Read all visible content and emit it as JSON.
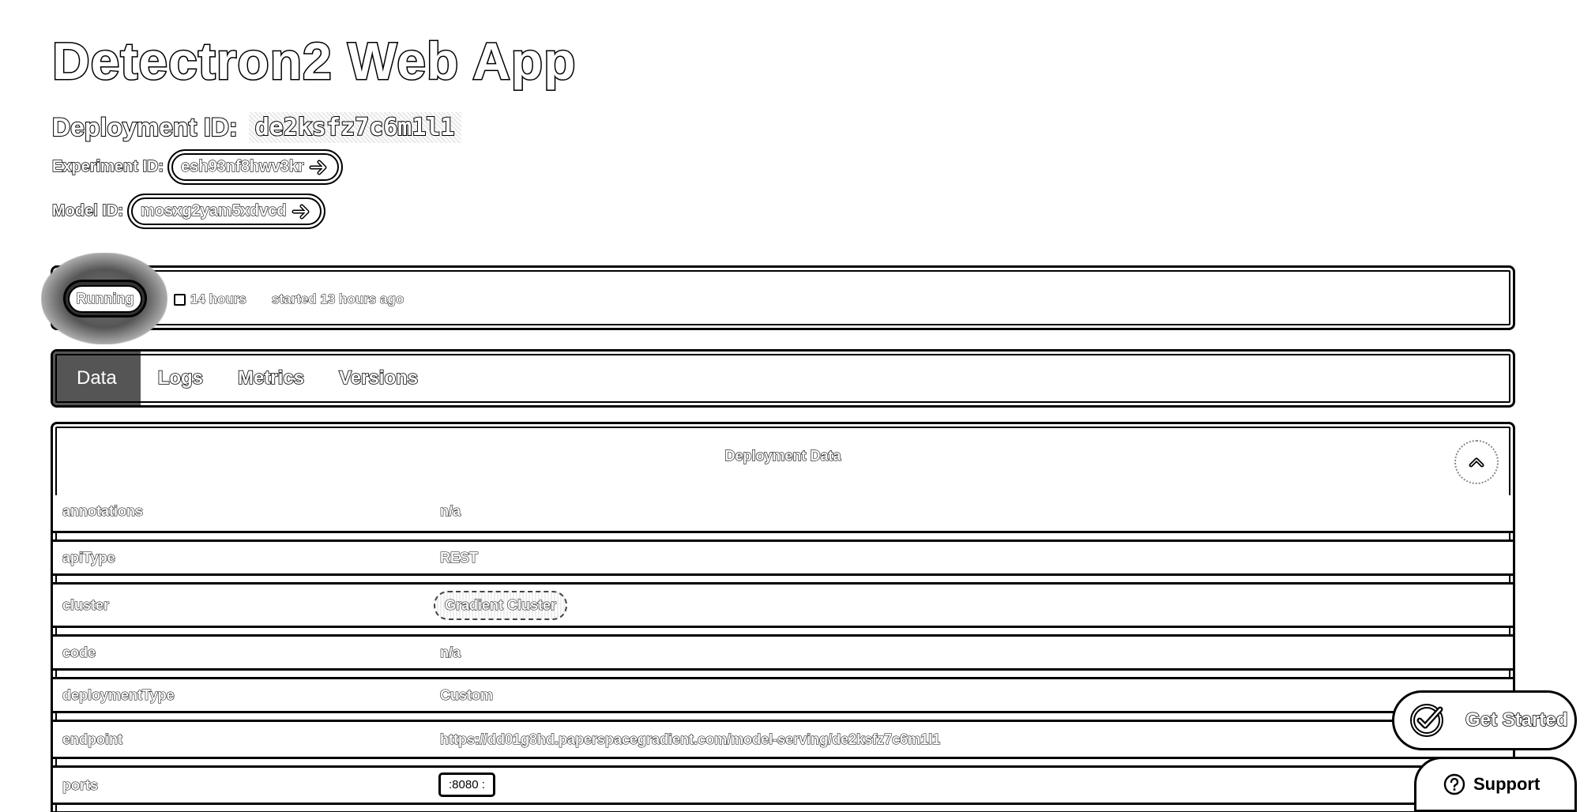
{
  "header": {
    "title": "Detectron2 Web App",
    "deployment_label": "Deployment ID:",
    "deployment_id": "de2ksfz7c6m1l1",
    "experiment_label": "Experiment ID:",
    "experiment_id": "esh93nf8hwv3kr",
    "model_label": "Model ID:",
    "model_id": "mosxg2yam5xdvcd"
  },
  "status": {
    "state": "Running",
    "duration": "14 hours",
    "started": "started 13 hours ago"
  },
  "tabs": [
    {
      "label": "Data",
      "active": true
    },
    {
      "label": "Logs",
      "active": false
    },
    {
      "label": "Metrics",
      "active": false
    },
    {
      "label": "Versions",
      "active": false
    }
  ],
  "panel": {
    "title": "Deployment Data",
    "rows": [
      {
        "key": "annotations",
        "value": "n/a"
      },
      {
        "key": "apiType",
        "value": "REST"
      },
      {
        "key": "cluster",
        "value": "Gradient Cluster"
      },
      {
        "key": "code",
        "value": "n/a"
      },
      {
        "key": "deploymentType",
        "value": "Custom"
      },
      {
        "key": "endpoint",
        "value": "https://dd01g8hd.paperspacegradient.com/model-serving/de2ksfz7c6m1l1"
      },
      {
        "key": "ports",
        "value": ":8080 :"
      }
    ]
  },
  "floating": {
    "get_started": "Get Started",
    "support": "Support"
  }
}
